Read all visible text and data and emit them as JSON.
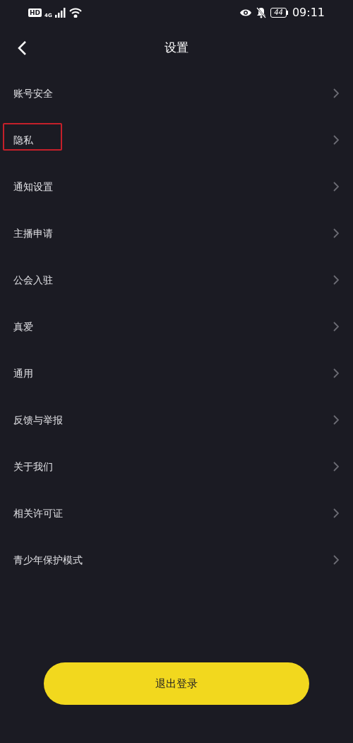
{
  "status_bar": {
    "hd": "HD",
    "network": "4G",
    "battery": "44",
    "time": "09:11"
  },
  "header": {
    "title": "设置"
  },
  "items": [
    {
      "label": "账号安全",
      "highlighted": false
    },
    {
      "label": "隐私",
      "highlighted": true
    },
    {
      "label": "通知设置",
      "highlighted": false
    },
    {
      "label": "主播申请",
      "highlighted": false
    },
    {
      "label": "公会入驻",
      "highlighted": false
    },
    {
      "label": "真爱",
      "highlighted": false
    },
    {
      "label": "通用",
      "highlighted": false
    },
    {
      "label": "反馈与举报",
      "highlighted": false
    },
    {
      "label": "关于我们",
      "highlighted": false
    },
    {
      "label": "相关许可证",
      "highlighted": false
    },
    {
      "label": "青少年保护模式",
      "highlighted": false
    }
  ],
  "logout_button": "退出登录"
}
